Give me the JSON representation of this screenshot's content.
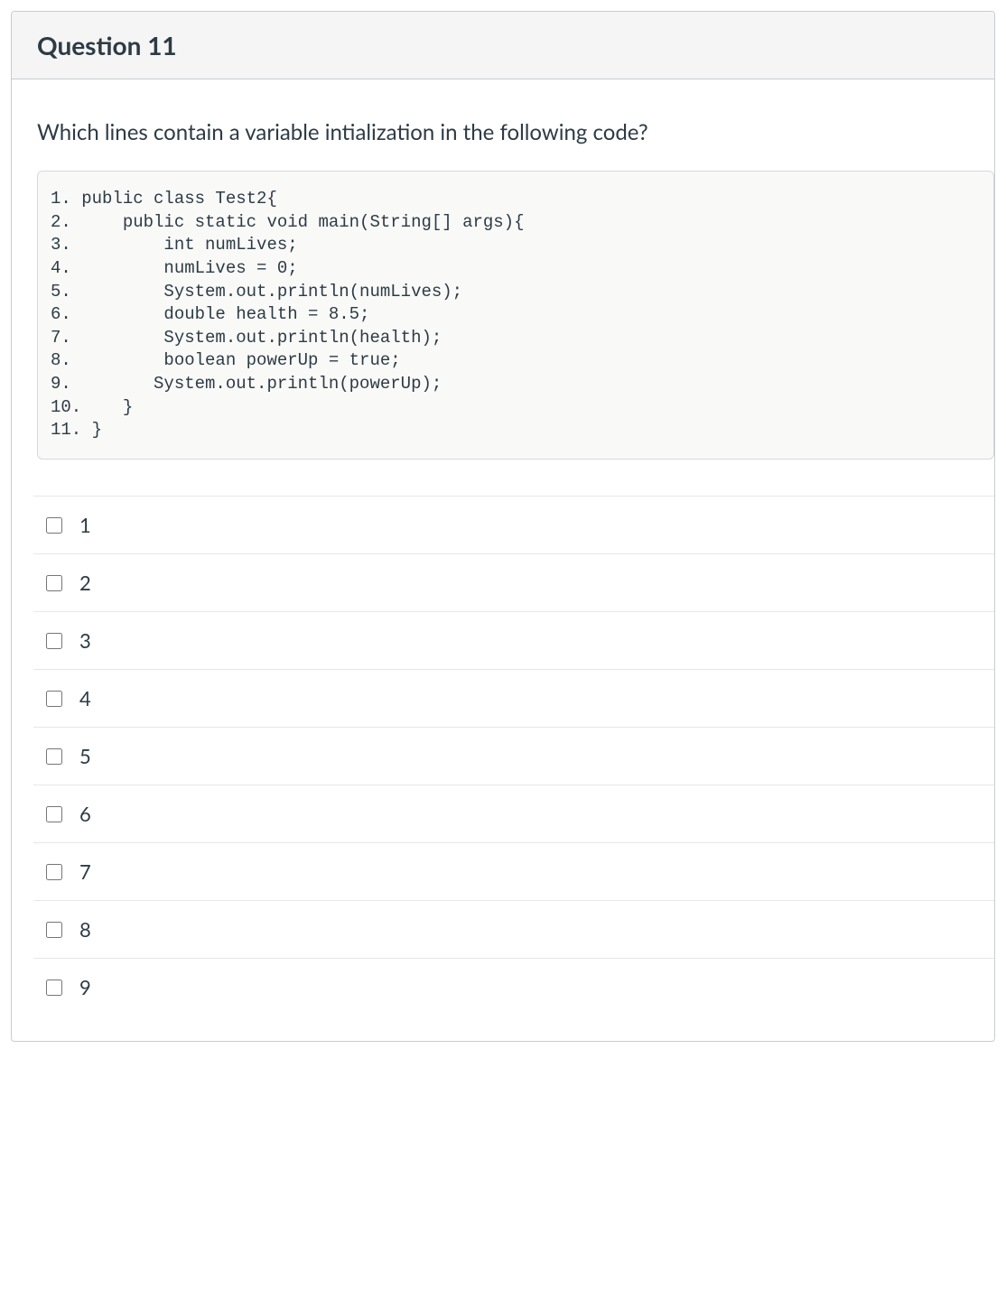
{
  "header": {
    "title": "Question 11"
  },
  "body": {
    "prompt": "Which lines contain a variable intialization in the following code?",
    "code_lines": [
      "1. public class Test2{",
      "2.     public static void main(String[] args){",
      "3.         int numLives;",
      "4.         numLives = 0;",
      "5.         System.out.println(numLives);",
      "6.         double health = 8.5;",
      "7.         System.out.println(health);",
      "8.         boolean powerUp = true;",
      "9.        System.out.println(powerUp);",
      "10.    }",
      "11. }"
    ],
    "options": [
      {
        "label": "1",
        "checked": false
      },
      {
        "label": "2",
        "checked": false
      },
      {
        "label": "3",
        "checked": false
      },
      {
        "label": "4",
        "checked": false
      },
      {
        "label": "5",
        "checked": false
      },
      {
        "label": "6",
        "checked": false
      },
      {
        "label": "7",
        "checked": false
      },
      {
        "label": "8",
        "checked": false
      },
      {
        "label": "9",
        "checked": false
      }
    ]
  }
}
